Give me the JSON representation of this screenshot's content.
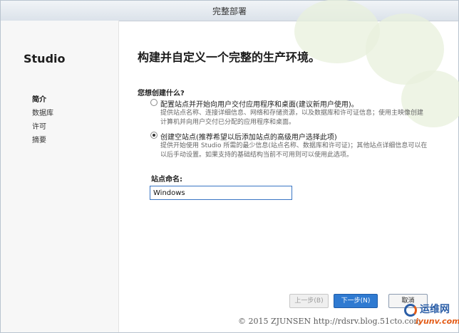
{
  "window": {
    "title": "完整部署"
  },
  "sidebar": {
    "brand": "Studio",
    "items": [
      {
        "label": "简介",
        "active": true
      },
      {
        "label": "数据库",
        "active": false
      },
      {
        "label": "许可",
        "active": false
      },
      {
        "label": "摘要",
        "active": false
      }
    ]
  },
  "main": {
    "heading": "构建并自定义一个完整的生产环境。",
    "question": "您想创建什么?",
    "options": [
      {
        "label": "配置站点并开始向用户交付应用程序和桌面(建议新用户使用)。",
        "description": "提供站点名称、连接详细信息、网络和存储资源，以及数据库和许可证信息；使用主映像创建计算机并向用户交付已分配的应用程序和桌面。",
        "selected": false
      },
      {
        "label": "创建空站点(推荐希望以后添加站点的高级用户选择此项)",
        "description": "提供开始使用 Studio 所需的最少信息(站点名称、数据库和许可证)；其他站点详细信息可以在以后手动设置。如果支持的基础结构当前不可用则可以使用此选项。",
        "selected": true
      }
    ],
    "site_name_label": "站点命名:",
    "site_name_value": "Windows"
  },
  "buttons": {
    "back": "上一步(B)",
    "next": "下一步(N)",
    "cancel": "取消"
  },
  "footer": {
    "watermark": "© 2015 ZJUNSEN http://rdsrv.blog.51cto.com",
    "logo_top": "运维网",
    "logo_bottom": "iyunv.com"
  },
  "colors": {
    "accent": "#2f7ad1",
    "deco": "#e8f0dc"
  }
}
